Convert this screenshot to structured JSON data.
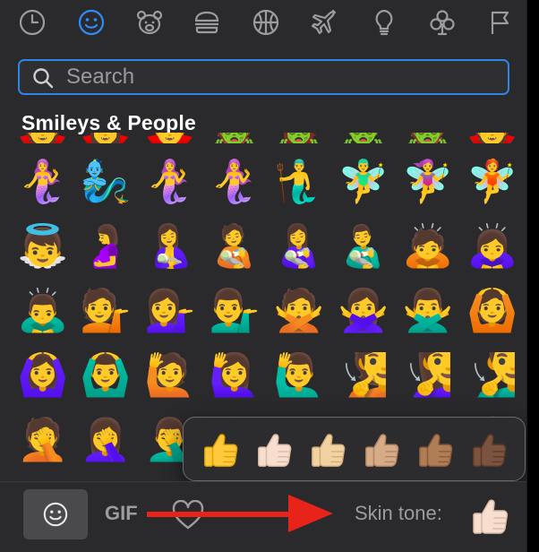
{
  "categories": [
    {
      "name": "clock-icon",
      "label": "Frequently Used",
      "active": false
    },
    {
      "name": "smiley-icon",
      "label": "Smileys & People",
      "active": true
    },
    {
      "name": "bear-icon",
      "label": "Animals & Nature",
      "active": false
    },
    {
      "name": "burger-icon",
      "label": "Food & Drink",
      "active": false
    },
    {
      "name": "ball-icon",
      "label": "Activity",
      "active": false
    },
    {
      "name": "airplane-icon",
      "label": "Travel & Places",
      "active": false
    },
    {
      "name": "lightbulb-icon",
      "label": "Objects",
      "active": false
    },
    {
      "name": "club-icon",
      "label": "Symbols",
      "active": false
    },
    {
      "name": "flag-icon",
      "label": "Flags",
      "active": false
    }
  ],
  "search": {
    "placeholder": "Search",
    "value": ""
  },
  "section": {
    "title": "Smileys & People"
  },
  "emoji_rows": [
    [
      "🧜‍♀️",
      "🧞‍♂️",
      "🧜‍♀️",
      "🧜‍♀️",
      "🧜‍♂️",
      "🧚‍♂️",
      "🧚‍♀️",
      "🧚"
    ],
    [
      "👼",
      "🤰",
      "🤱",
      "🧑‍🍼",
      "👩‍🍼",
      "👨‍🍼",
      "🙇",
      "🙇‍♀️"
    ],
    [
      "🙇‍♂️",
      "💁",
      "💁‍♀️",
      "💁‍♂️",
      "🙅",
      "🙅‍♀️",
      "🙅‍♂️",
      "🙆"
    ],
    [
      "🙆‍♀️",
      "🙆‍♂️",
      "🙋",
      "🙋‍♀️",
      "🙋‍♂️",
      "🧏",
      "🧏‍♀️",
      "🧏‍♂️"
    ],
    [
      "🤦",
      "🤦‍♀️",
      "🤦‍♂️",
      "🤷",
      "🤷‍♀️",
      "🤷‍♂️",
      "🙎",
      "🙎‍♀️"
    ]
  ],
  "clipped_row": [
    "🧛",
    "🧛‍♀️",
    "🧛‍♂️",
    "🧟",
    "🧟‍♀️",
    "🧟‍♂️",
    "🧟",
    "🧛"
  ],
  "skin_tones": {
    "options": [
      {
        "name": "default",
        "color": "#ffc83d",
        "outline": "#e0a200"
      },
      {
        "name": "light",
        "color": "#f7dece",
        "outline": "#d8bba8"
      },
      {
        "name": "medium-light",
        "color": "#f3d2a2",
        "outline": "#d1ad7a"
      },
      {
        "name": "medium",
        "color": "#d5ab88",
        "outline": "#b08563"
      },
      {
        "name": "medium-dark",
        "color": "#af7e57",
        "outline": "#8c5c38"
      },
      {
        "name": "dark",
        "color": "#7c533e",
        "outline": "#5a3a2a"
      }
    ],
    "selected_color": "#f7dece",
    "selected_outline": "#d8bba8"
  },
  "bottom": {
    "gif_label": "GIF",
    "skin_tone_label": "Skin tone:"
  },
  "colors": {
    "accent": "#2f8cf6",
    "annotation_arrow": "#e8241a",
    "background": "#2a2a2c"
  }
}
